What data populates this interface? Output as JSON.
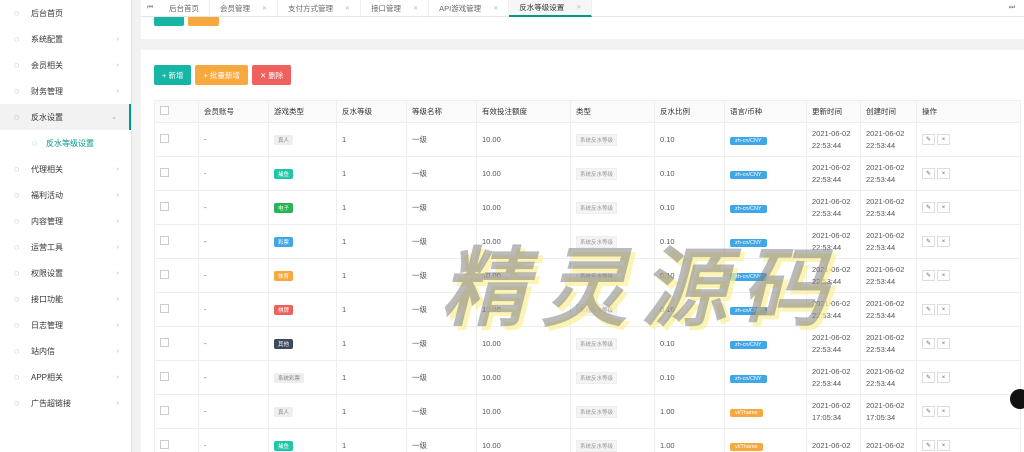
{
  "sidebar": {
    "items": [
      {
        "label": "后台首页",
        "arrow": ""
      },
      {
        "label": "系统配置",
        "arrow": "›"
      },
      {
        "label": "会员相关",
        "arrow": "›"
      },
      {
        "label": "财务管理",
        "arrow": "›"
      },
      {
        "label": "反水设置",
        "arrow": "⌄"
      },
      {
        "label": "代理相关",
        "arrow": "›"
      },
      {
        "label": "福利活动",
        "arrow": "›"
      },
      {
        "label": "内容管理",
        "arrow": "›"
      },
      {
        "label": "运营工具",
        "arrow": "›"
      },
      {
        "label": "权限设置",
        "arrow": "›"
      },
      {
        "label": "接口功能",
        "arrow": "›"
      },
      {
        "label": "日志管理",
        "arrow": "›"
      },
      {
        "label": "站内信",
        "arrow": "›"
      },
      {
        "label": "APP相关",
        "arrow": "›"
      },
      {
        "label": "广告超链接",
        "arrow": "›"
      }
    ],
    "sub_item": "反水等级设置"
  },
  "tabs": [
    "后台首页",
    "会员管理",
    "支付方式管理",
    "接口管理",
    "API游戏管理",
    "反水等级设置"
  ],
  "toolbar": {
    "add": "+ 新增",
    "batch_add": "+ 批量新增",
    "delete": "✕ 删除"
  },
  "table": {
    "headers": [
      "会员账号",
      "游戏类型",
      "反水等级",
      "等级名称",
      "有效投注额度",
      "类型",
      "反水比例",
      "语言/币种",
      "更新时间",
      "创建时间",
      "操作"
    ],
    "rows": [
      {
        "account": "-",
        "game": "真人",
        "game_color": "#eeeeee",
        "level": "1",
        "name": "一级",
        "bet": "10.00",
        "type": "系统反水等级",
        "ratio": "0.10",
        "lang": "zh-cn/CNY",
        "lang_color": "#3fa7e8",
        "updated": [
          "2021-06-02",
          "22:53:44"
        ],
        "created": [
          "2021-06-02",
          "22:53:44"
        ]
      },
      {
        "account": "-",
        "game": "捕鱼",
        "game_color": "#1ec6a8",
        "level": "1",
        "name": "一级",
        "bet": "10.00",
        "type": "系统反水等级",
        "ratio": "0.10",
        "lang": "zh-cn/CNY",
        "lang_color": "#3fa7e8",
        "updated": [
          "2021-06-02",
          "22:53:44"
        ],
        "created": [
          "2021-06-02",
          "22:53:44"
        ]
      },
      {
        "account": "-",
        "game": "电子",
        "game_color": "#26b556",
        "level": "1",
        "name": "一级",
        "bet": "10.00",
        "type": "系统反水等级",
        "ratio": "0.10",
        "lang": "zh-cn/CNY",
        "lang_color": "#3fa7e8",
        "updated": [
          "2021-06-02",
          "22:53:44"
        ],
        "created": [
          "2021-06-02",
          "22:53:44"
        ]
      },
      {
        "account": "-",
        "game": "彩票",
        "game_color": "#3fa7e8",
        "level": "1",
        "name": "一级",
        "bet": "10.00",
        "type": "系统反水等级",
        "ratio": "0.10",
        "lang": "zh-cn/CNY",
        "lang_color": "#3fa7e8",
        "updated": [
          "2021-06-02",
          "22:53:44"
        ],
        "created": [
          "2021-06-02",
          "22:53:44"
        ]
      },
      {
        "account": "-",
        "game": "体育",
        "game_color": "#f7a940",
        "level": "1",
        "name": "一级",
        "bet": "10.00",
        "type": "系统反水等级",
        "ratio": "0.10",
        "lang": "zh-cn/CNY",
        "lang_color": "#3fa7e8",
        "updated": [
          "2021-06-02",
          "22:53:44"
        ],
        "created": [
          "2021-06-02",
          "22:53:44"
        ]
      },
      {
        "account": "-",
        "game": "棋牌",
        "game_color": "#f0605d",
        "level": "1",
        "name": "一级",
        "bet": "10.00",
        "type": "系统反水等级",
        "ratio": "0.10",
        "lang": "zh-cn/CNY",
        "lang_color": "#3fa7e8",
        "updated": [
          "2021-06-02",
          "22:53:44"
        ],
        "created": [
          "2021-06-02",
          "22:53:44"
        ]
      },
      {
        "account": "-",
        "game": "其他",
        "game_color": "#3d4a5c",
        "level": "1",
        "name": "一级",
        "bet": "10.00",
        "type": "系统反水等级",
        "ratio": "0.10",
        "lang": "zh-cn/CNY",
        "lang_color": "#3fa7e8",
        "updated": [
          "2021-06-02",
          "22:53:44"
        ],
        "created": [
          "2021-06-02",
          "22:53:44"
        ]
      },
      {
        "account": "-",
        "game": "系统彩票",
        "game_color": "#eeeeee",
        "level": "1",
        "name": "一级",
        "bet": "10.00",
        "type": "系统反水等级",
        "ratio": "0.10",
        "lang": "zh-cn/CNY",
        "lang_color": "#3fa7e8",
        "updated": [
          "2021-06-02",
          "22:53:44"
        ],
        "created": [
          "2021-06-02",
          "22:53:44"
        ]
      },
      {
        "account": "-",
        "game": "真人",
        "game_color": "#eeeeee",
        "level": "1",
        "name": "一级",
        "bet": "10.00",
        "type": "系统反水等级",
        "ratio": "1.00",
        "lang": "vi/Thame",
        "lang_color": "#f7a940",
        "updated": [
          "2021-06-02",
          "17:05:34"
        ],
        "created": [
          "2021-06-02",
          "17:05:34"
        ]
      },
      {
        "account": "-",
        "game": "捕鱼",
        "game_color": "#1ec6a8",
        "level": "1",
        "name": "一级",
        "bet": "10.00",
        "type": "系统反水等级",
        "ratio": "1.00",
        "lang": "vi/Thame",
        "lang_color": "#f7a940",
        "updated": [
          "2021-06-02",
          ""
        ],
        "created": [
          "2021-06-02",
          ""
        ]
      }
    ],
    "op_edit": "✎",
    "op_delete": "×"
  },
  "watermark": "精灵源码"
}
